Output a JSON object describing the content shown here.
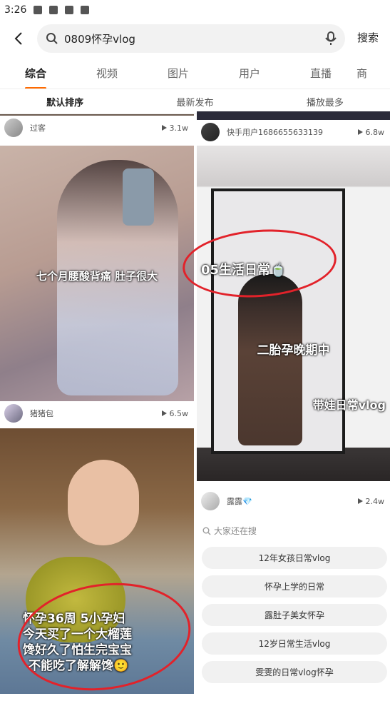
{
  "status_bar": {
    "time": "3:26"
  },
  "search": {
    "query": "0809怀孕vlog",
    "button_label": "搜索"
  },
  "tabs": [
    "综合",
    "视频",
    "图片",
    "用户",
    "直播",
    "商"
  ],
  "sort": [
    "默认排序",
    "最新发布",
    "播放最多"
  ],
  "cards": {
    "top_left": {
      "user": "过客",
      "views": "3.1w"
    },
    "top_right": {
      "user": "快手用户1686655633139",
      "views": "6.8w"
    },
    "mid_left": {
      "caption": "七个月腰酸背痛 肚子很大",
      "user": "猪猪包",
      "views": "6.5w"
    },
    "mid_right": {
      "caption1": "05生活日常🍵",
      "caption2": "二胎孕晚期中",
      "caption3": "带娃日常vlog",
      "user": "露露💎",
      "views": "2.4w"
    },
    "bottom_left": {
      "caption1": "怀孕36周  5小孕妇",
      "caption2": "今天买了一个大榴莲",
      "caption3": "馋好久了怕生完宝宝",
      "caption4": "不能吃了解解馋🙂"
    }
  },
  "suggestions": {
    "title": "大家还在搜",
    "items": [
      "12年女孩日常vlog",
      "怀孕上学的日常",
      "露肚子美女怀孕",
      "12岁日常生活vlog",
      "雯雯的日常vlog怀孕"
    ]
  },
  "colors": {
    "accent": "#ff6a00",
    "highlight_ring": "#e2222a"
  }
}
